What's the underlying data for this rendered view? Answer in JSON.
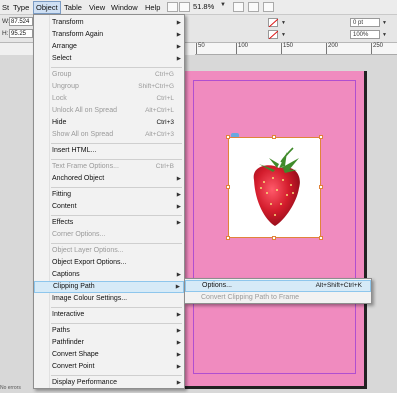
{
  "menubar": {
    "items": [
      {
        "label": "St"
      },
      {
        "label": "Type"
      },
      {
        "label": "Object"
      },
      {
        "label": "Table"
      },
      {
        "label": "View"
      },
      {
        "label": "Window"
      },
      {
        "label": "Help"
      }
    ],
    "zoom": "51.8%"
  },
  "control": {
    "w_label": "W:",
    "w_value": "87.524",
    "h_label": "H:",
    "h_value": "95.25",
    "stroke_weight": "0 pt",
    "scale_value": "100%"
  },
  "ruler": {
    "ticks": [
      "50",
      "100",
      "150",
      "200",
      "250"
    ]
  },
  "object_menu": {
    "items": [
      {
        "label": "Transform",
        "submenu": true
      },
      {
        "label": "Transform Again",
        "submenu": true
      },
      {
        "label": "Arrange",
        "submenu": true
      },
      {
        "label": "Select",
        "submenu": true
      },
      {
        "label": "Group",
        "shortcut": "Ctrl+G",
        "disabled": true
      },
      {
        "label": "Ungroup",
        "shortcut": "Shift+Ctrl+G",
        "disabled": true
      },
      {
        "label": "Lock",
        "shortcut": "Ctrl+L",
        "disabled": true
      },
      {
        "label": "Unlock All on Spread",
        "shortcut": "Alt+Ctrl+L",
        "disabled": true
      },
      {
        "label": "Hide",
        "shortcut": "Ctrl+3"
      },
      {
        "label": "Show All on Spread",
        "shortcut": "Alt+Ctrl+3",
        "disabled": true
      },
      {
        "label": "Insert HTML..."
      },
      {
        "label": "Text Frame Options...",
        "shortcut": "Ctrl+B",
        "disabled": true
      },
      {
        "label": "Anchored Object",
        "submenu": true
      },
      {
        "label": "Fitting",
        "submenu": true
      },
      {
        "label": "Content",
        "submenu": true
      },
      {
        "label": "Effects",
        "submenu": true
      },
      {
        "label": "Corner Options...",
        "disabled": true
      },
      {
        "label": "Object Layer Options...",
        "disabled": true
      },
      {
        "label": "Object Export Options..."
      },
      {
        "label": "Captions",
        "submenu": true
      },
      {
        "label": "Clipping Path",
        "submenu": true,
        "highlighted": true
      },
      {
        "label": "Image Colour Settings..."
      },
      {
        "label": "Interactive",
        "submenu": true
      },
      {
        "label": "Paths",
        "submenu": true
      },
      {
        "label": "Pathfinder",
        "submenu": true
      },
      {
        "label": "Convert Shape",
        "submenu": true
      },
      {
        "label": "Convert Point",
        "submenu": true
      },
      {
        "label": "Display Performance",
        "submenu": true
      }
    ]
  },
  "clipping_submenu": {
    "items": [
      {
        "label": "Options...",
        "shortcut": "Alt+Shift+Ctrl+K",
        "highlighted": true
      },
      {
        "label": "Convert Clipping Path to Frame",
        "disabled": true
      }
    ]
  },
  "status": {
    "text": "No errors"
  },
  "icons": {
    "submenu_arrow": "triangle-right-icon",
    "image_content": "strawberry-image"
  },
  "colors": {
    "page_fill": "#f08bbf",
    "highlight": "#d6eaf7",
    "frame_selection": "#e0843a",
    "margin_guide": "#b04fd0"
  }
}
